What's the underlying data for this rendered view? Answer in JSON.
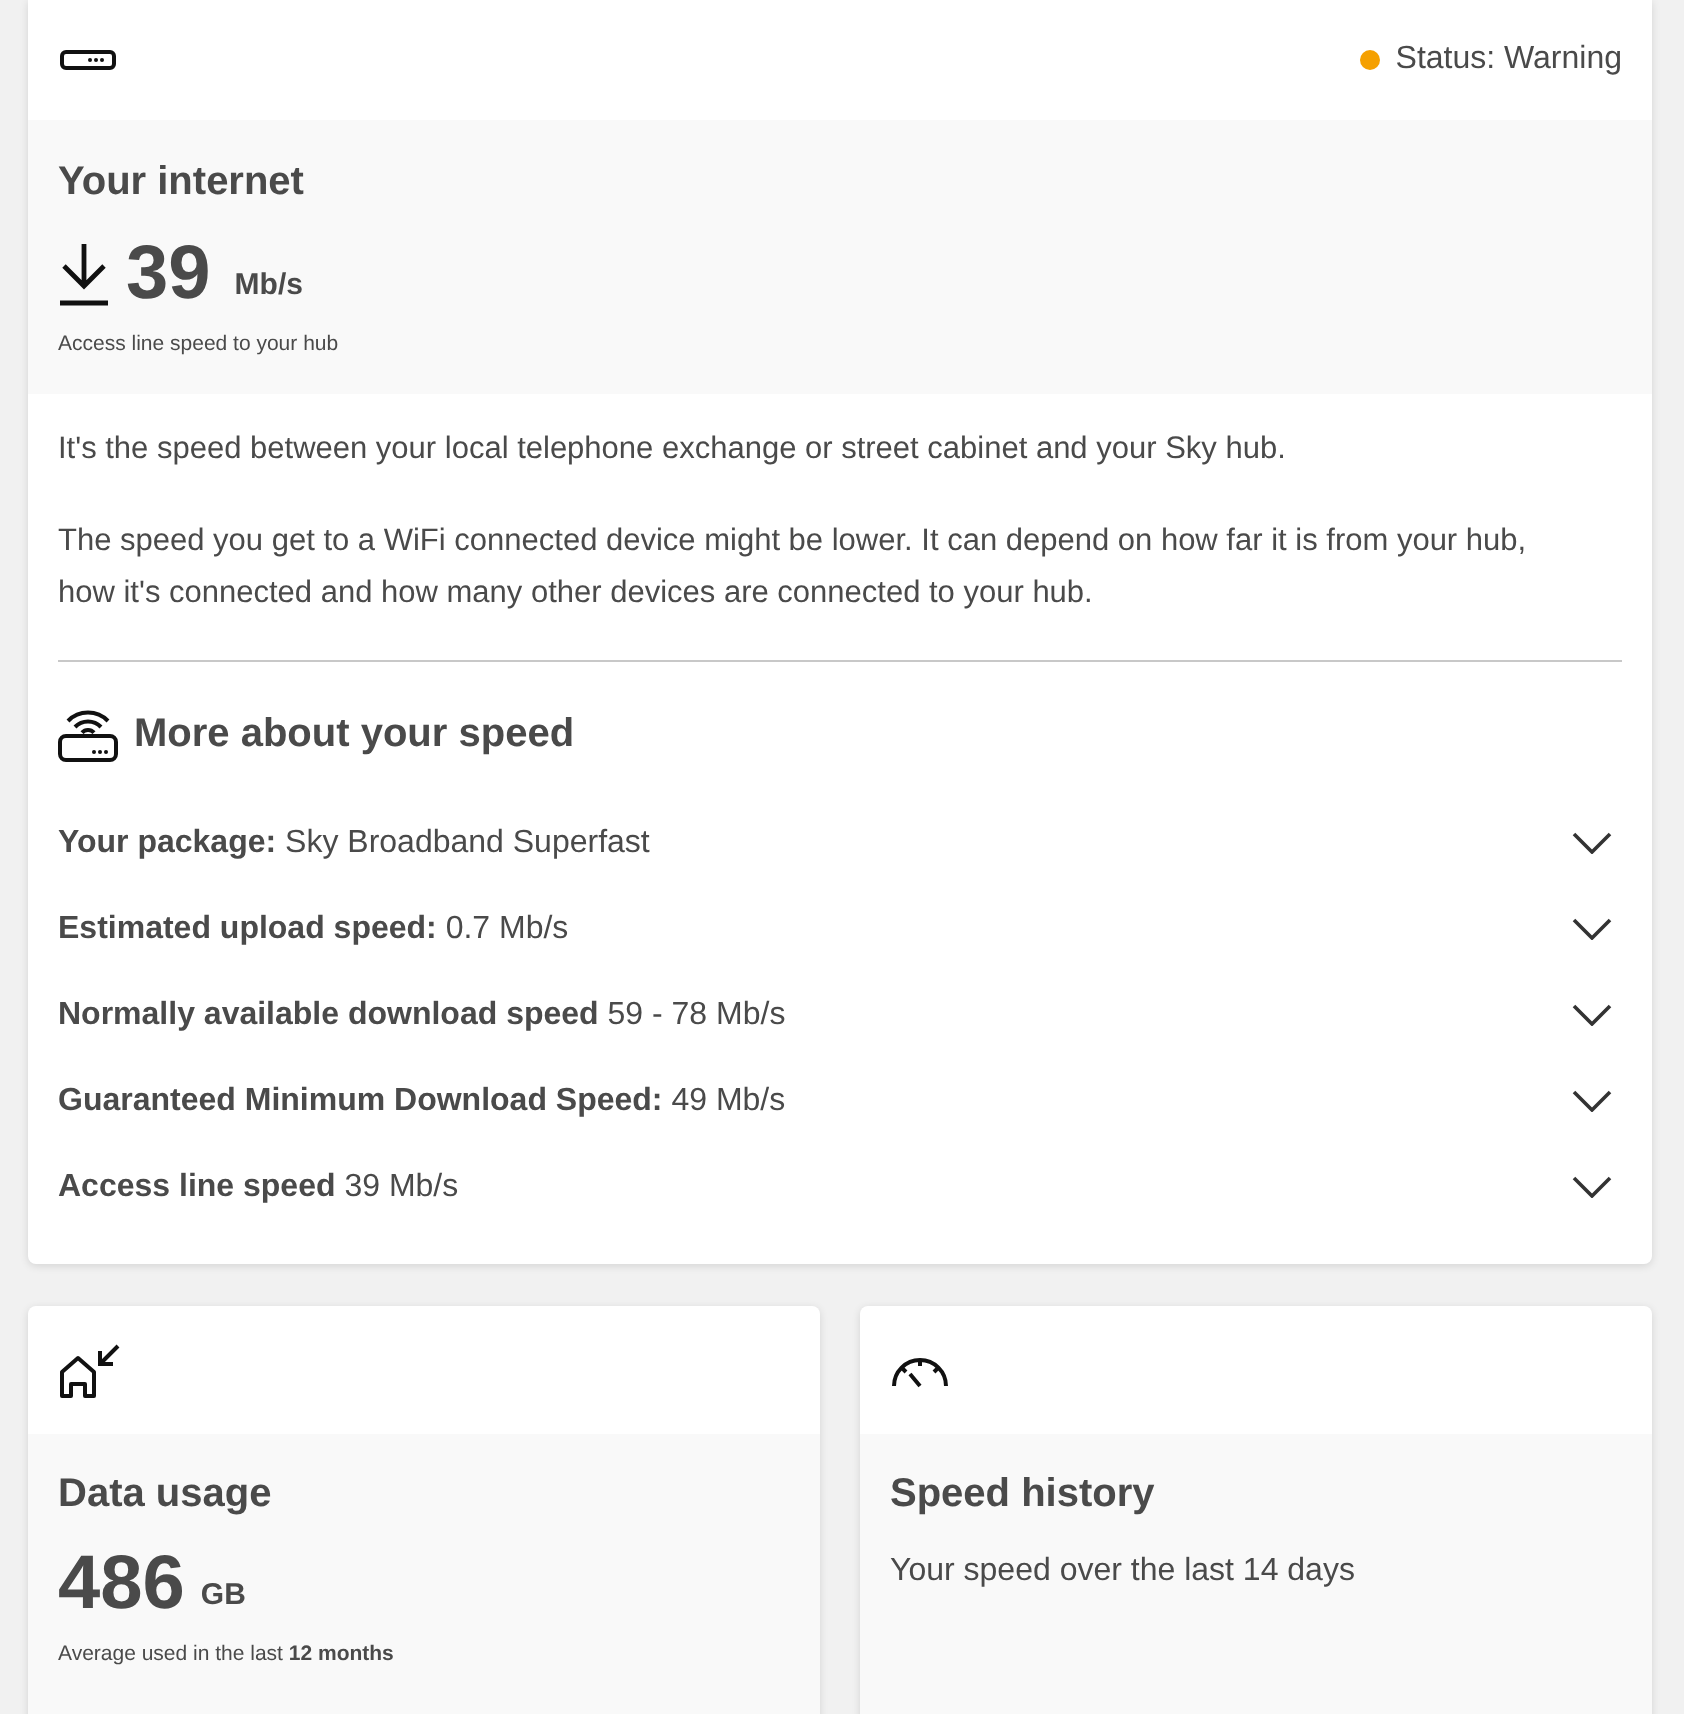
{
  "internet": {
    "status": {
      "label": "Status: Warning",
      "color": "#f5a000"
    },
    "title": "Your internet",
    "speed": {
      "value": "39",
      "unit": "Mb/s",
      "caption": "Access line speed to your hub"
    },
    "paragraphs": [
      "It's the speed between your local telephone exchange or street cabinet and your Sky hub.",
      "The speed you get to a WiFi connected device might be lower. It can depend on how far it is from your hub, how it's connected and how many other devices are connected to your hub."
    ],
    "more": {
      "title": "More about your speed",
      "rows": [
        {
          "label": "Your package:",
          "value": "Sky Broadband Superfast",
          "expanded": false
        },
        {
          "label": "Estimated upload speed:",
          "value": "0.7 Mb/s",
          "expanded": false
        },
        {
          "label": "Normally available download speed",
          "value": "59 - 78 Mb/s",
          "expanded": false
        },
        {
          "label": "Guaranteed Minimum Download Speed:",
          "value": "49 Mb/s",
          "expanded": false
        },
        {
          "label": "Access line speed",
          "value": "39 Mb/s",
          "expanded": false
        }
      ]
    }
  },
  "tiles": [
    {
      "kind": "usage",
      "title": "Data usage",
      "value": "486",
      "unit": "GB",
      "caption": "Average used in the last **12 months**"
    },
    {
      "kind": "history",
      "title": "Speed history",
      "text": "Your speed over the last 14 days"
    }
  ]
}
